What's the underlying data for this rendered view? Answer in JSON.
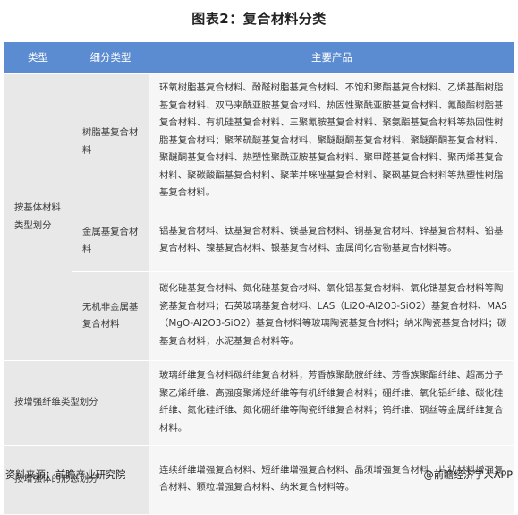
{
  "title": "图表2：复合材料分类",
  "table": {
    "headers": [
      "类型",
      "细分类型",
      "主要产品"
    ],
    "categories": {
      "matrix": "按基体材料类型划分",
      "reinforce_type": "按增强纤维类型划分",
      "reinforce_form": "按增强体的形态划分"
    },
    "rows": [
      {
        "subtype": "树脂基复合材料",
        "products": "环氧树脂基复合材料、酚醛树脂基复合材料、不饱和聚酯基复合材料、乙烯基酯树脂基复合材料、双马来酰亚胺基复合材料、热固性聚酰亚胺基复合材料、氰酸酯树脂基复合材料、有机硅基复合材料、三聚氰胺基复合材料、聚氨酯基复合材料等热固性树脂基复合材料；聚苯硫醚基复合材料、聚醚醚酮基复合材料、聚醚酮酮基复合材料、聚醚酮基复合材料、热塑性聚酰亚胺基复合材料、聚甲醛基复合材料、聚丙烯基复合材料、聚碳酸酯基复合材料、聚苯并咪唑基复合材料、聚砜基复合材料等热塑性树脂基复合材料。"
      },
      {
        "subtype": "金属基复合材料",
        "products": "铝基复合材料、钛基复合材料、镁基复合材料、铜基复合材料、锌基复合材料、铅基复合材料、镍基复合材料、银基复合材料、金属间化合物基复合材料等。"
      },
      {
        "subtype": "无机非金属基复合材料",
        "products": "碳化硅基复合材料、氮化硅基复合材料、氧化铝基复合材料、氧化锆基复合材料等陶瓷基复合材料；石英玻璃基复合材料、LAS（Li2O-Al2O3-SiO2）基复合材料、MAS（MgO-Al2O3-SiO2）基复合材料等玻璃陶瓷基复合材料；纳米陶瓷基复合材料；碳基复合材料；水泥基复合材料等。"
      },
      {
        "products": "玻璃纤维复合材料碳纤维复合材料；芳香族聚酰胺纤维、芳香族聚酯纤维、超高分子聚乙烯纤维、高强度聚烯烃纤维等有机纤维复合材料；硼纤维、氧化铝纤维、碳化硅纤维、氮化硅纤维、氮化硼纤维等陶瓷纤维复合材料；钨纤维、钢丝等金属纤维复合材料。"
      },
      {
        "products": "连续纤维增强复合材料、短纤维增强复合材料、晶须增强复合材料、片状材料增强复合材料、颗粒增强复合材料、纳米复合材料等。"
      }
    ]
  },
  "footer": {
    "source": "资料来源：前瞻产业研究院",
    "brand": "@前瞻经济学人APP"
  }
}
